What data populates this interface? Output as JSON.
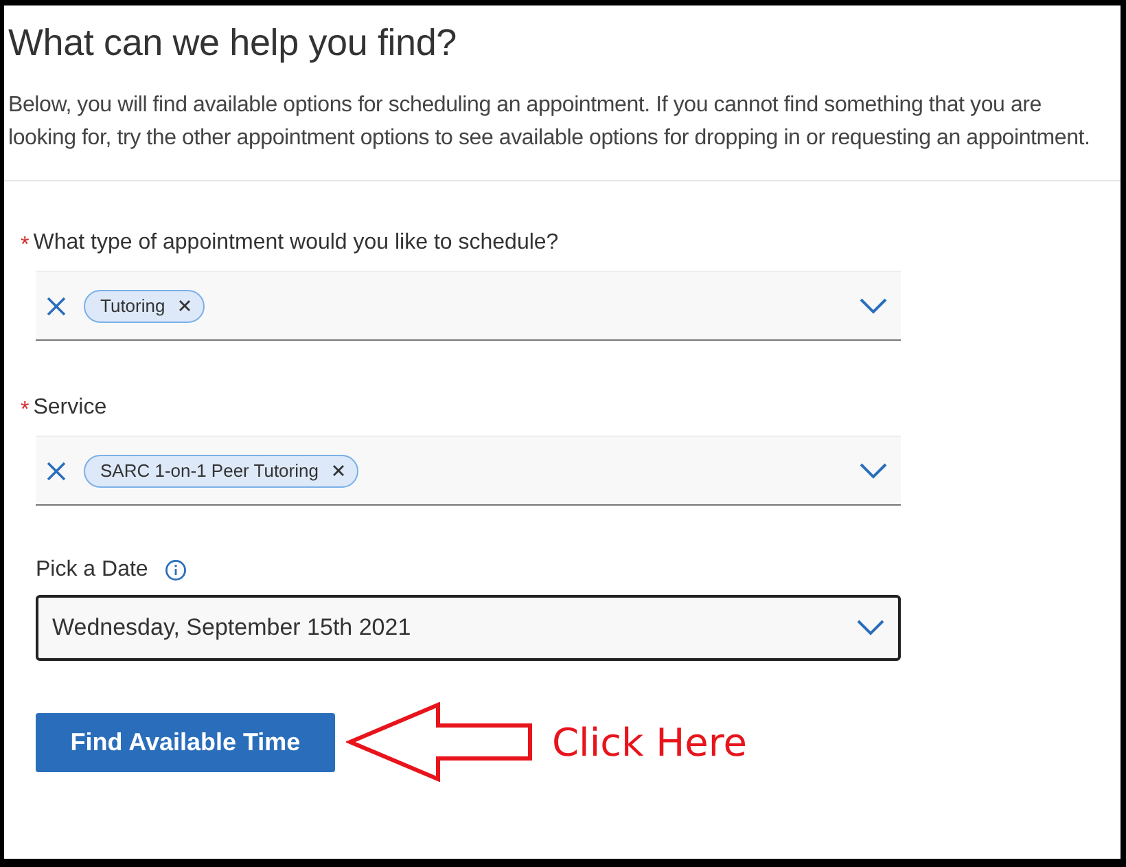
{
  "heading": "What can we help you find?",
  "intro": "Below, you will find available options for scheduling an appointment. If you cannot find something that you are looking for, try the other appointment options to see available options for dropping in or requesting an appointment.",
  "fields": [
    {
      "kind": "multiselect",
      "label": "What type of appointment would you like to schedule?",
      "required_mark": "*",
      "tags": [
        "Tutoring"
      ]
    },
    {
      "kind": "multiselect",
      "label": "Service",
      "required_mark": "*",
      "tags": [
        "SARC 1-on-1 Peer Tutoring"
      ]
    },
    {
      "kind": "date",
      "label": "Pick a Date",
      "info": true,
      "value": "Wednesday, September 15th 2021"
    }
  ],
  "button": "Find Available Time",
  "callout": "Click Here"
}
